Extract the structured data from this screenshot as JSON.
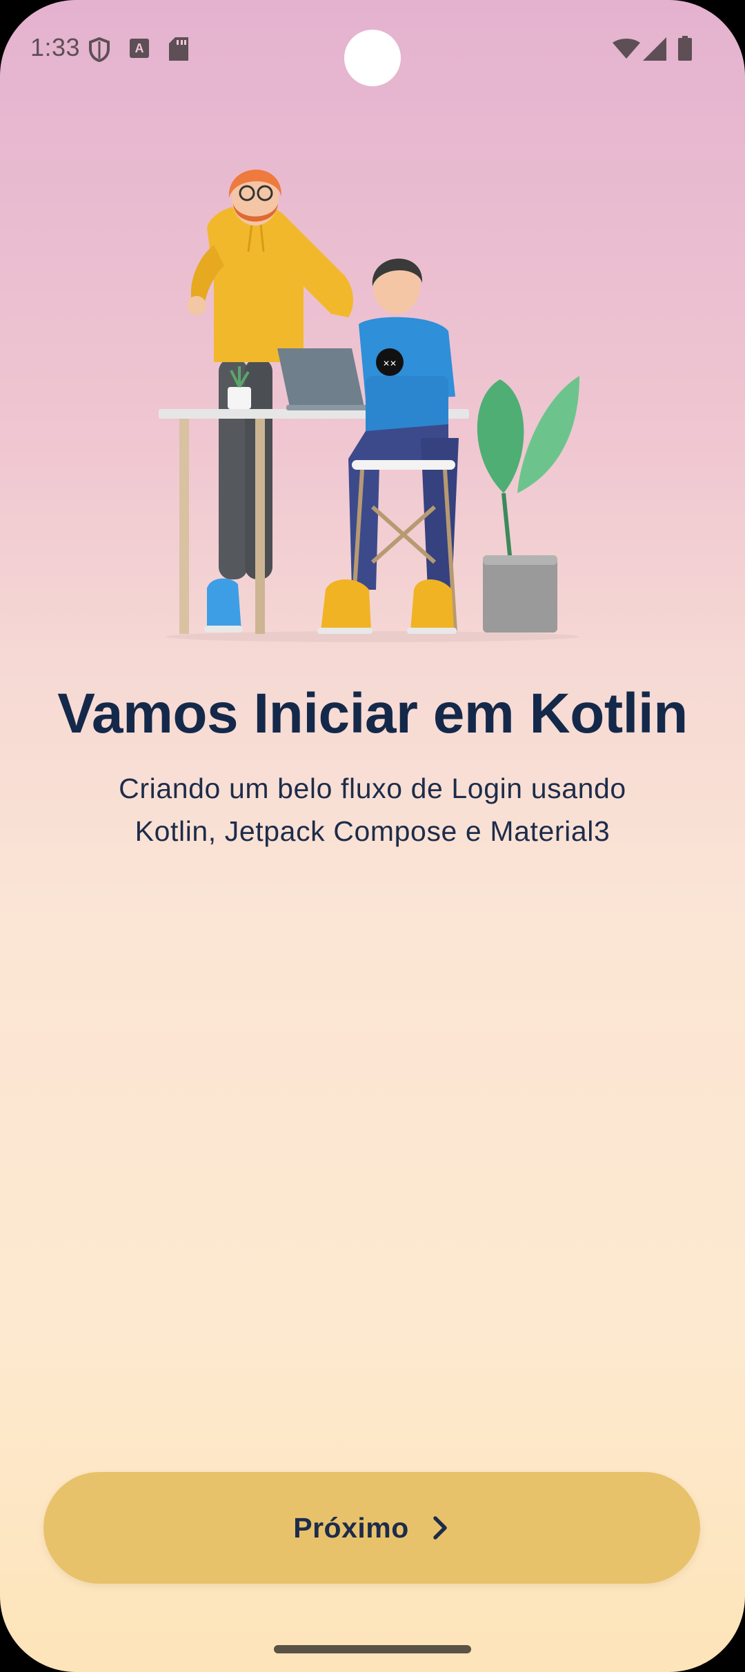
{
  "status_bar": {
    "time": "1:33",
    "icons": [
      "shield-icon",
      "a-icon",
      "sd-card-icon",
      "wifi-icon",
      "signal-icon",
      "battery-icon"
    ]
  },
  "onboarding": {
    "title": "Vamos Iniciar em Kotlin",
    "subtitle_line1": "Criando um belo fluxo de Login usando",
    "subtitle_line2": "Kotlin, Jetpack Compose e Material3",
    "next_label": "Próximo"
  },
  "colors": {
    "title": "#14294a",
    "button": "#e8c26a",
    "gradient_top": "#e4b2cf",
    "gradient_bottom": "#fde4b9"
  }
}
